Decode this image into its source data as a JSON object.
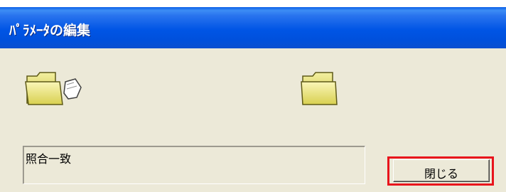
{
  "window": {
    "title": "ﾊﾟﾗﾒｰﾀの編集"
  },
  "icons": {
    "left": "folder-with-document-icon",
    "right": "folder-icon"
  },
  "status": {
    "text": "照合一致"
  },
  "buttons": {
    "close_label": "閉じる"
  },
  "colors": {
    "titlebar": "#0055E5",
    "window_bg": "#ECE9D8",
    "highlight": "#E8141C",
    "folder": "#E8E070"
  }
}
